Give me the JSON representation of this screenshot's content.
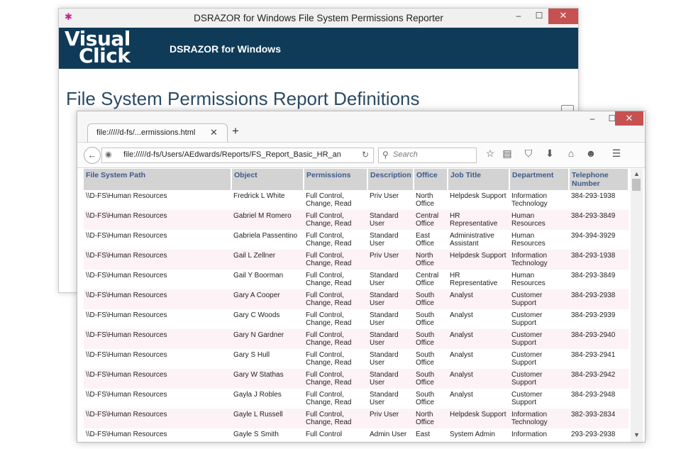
{
  "back_window": {
    "title": "DSRAZOR for Windows File System Permissions Reporter",
    "controls": {
      "minimize": "–",
      "maximize": "☐",
      "close": "✕"
    },
    "logo_line1": "Visual",
    "logo_line2": "Click",
    "product": "DSRAZOR for Windows",
    "heading": "File System Permissions Report Definitions"
  },
  "browser": {
    "controls": {
      "minimize": "–",
      "maximize": "☐",
      "close": "✕"
    },
    "tab": {
      "label": "file://///d-fs/...ermissions.html",
      "close": "✕"
    },
    "new_tab": "+",
    "url": "file://///d-fs/Users/AEdwards/Reports/FS_Report_Basic_HR_an",
    "search_placeholder": "Search"
  },
  "table": {
    "headers": [
      "File System Path",
      "Object",
      "Permissions",
      "Description",
      "Office",
      "Job Title",
      "Department",
      "Telephone Number"
    ],
    "rows": [
      [
        "\\\\D-FS\\Human Resources",
        "Fredrick L White",
        "Full Control, Change, Read",
        "Priv User",
        "North Office",
        "Helpdesk Support",
        "Information Technology",
        "384-293-1938"
      ],
      [
        "\\\\D-FS\\Human Resources",
        "Gabriel M Romero",
        "Full Control, Change, Read",
        "Standard User",
        "Central Office",
        "HR Representative",
        "Human Resources",
        "384-293-3849"
      ],
      [
        "\\\\D-FS\\Human Resources",
        "Gabriela Passentino",
        "Full Control, Change, Read",
        "Standard User",
        "East Office",
        "Administrative Assistant",
        "Human Resources",
        "394-394-3929"
      ],
      [
        "\\\\D-FS\\Human Resources",
        "Gail L Zellner",
        "Full Control, Change, Read",
        "Priv User",
        "North Office",
        "Helpdesk Support",
        "Information Technology",
        "384-293-1938"
      ],
      [
        "\\\\D-FS\\Human Resources",
        "Gail Y Boorman",
        "Full Control, Change, Read",
        "Standard User",
        "Central Office",
        "HR Representative",
        "Human Resources",
        "384-293-3849"
      ],
      [
        "\\\\D-FS\\Human Resources",
        "Gary A Cooper",
        "Full Control, Change, Read",
        "Standard User",
        "South Office",
        "Analyst",
        "Customer Support",
        "384-293-2938"
      ],
      [
        "\\\\D-FS\\Human Resources",
        "Gary C Woods",
        "Full Control, Change, Read",
        "Standard User",
        "South Office",
        "Analyst",
        "Customer Support",
        "384-293-2939"
      ],
      [
        "\\\\D-FS\\Human Resources",
        "Gary N Gardner",
        "Full Control, Change, Read",
        "Standard User",
        "South Office",
        "Analyst",
        "Customer Support",
        "384-293-2940"
      ],
      [
        "\\\\D-FS\\Human Resources",
        "Gary S Hull",
        "Full Control, Change, Read",
        "Standard User",
        "South Office",
        "Analyst",
        "Customer Support",
        "384-293-2941"
      ],
      [
        "\\\\D-FS\\Human Resources",
        "Gary W Stathas",
        "Full Control, Change, Read",
        "Standard User",
        "South Office",
        "Analyst",
        "Customer Support",
        "384-293-2942"
      ],
      [
        "\\\\D-FS\\Human Resources",
        "Gayla J Robles",
        "Full Control, Change, Read",
        "Standard User",
        "South Office",
        "Analyst",
        "Customer Support",
        "384-293-2948"
      ],
      [
        "\\\\D-FS\\Human Resources",
        "Gayle L Russell",
        "Full Control, Change, Read",
        "Priv User",
        "North Office",
        "Helpdesk Support",
        "Information Technology",
        "382-393-2834"
      ],
      [
        "\\\\D-FS\\Human Resources",
        "Gayle S Smith",
        "Full Control",
        "Admin User",
        "East",
        "System Admin",
        "Information",
        "293-293-2938"
      ]
    ]
  }
}
